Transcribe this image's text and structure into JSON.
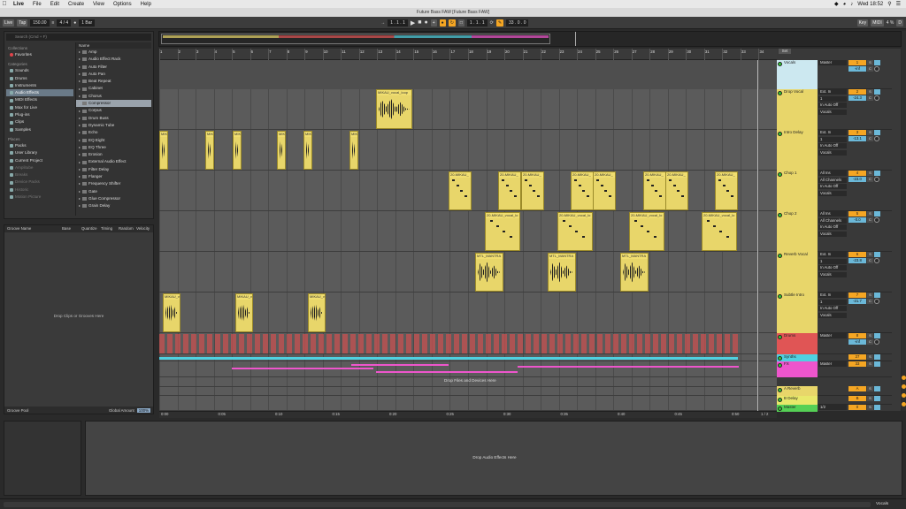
{
  "menubar": {
    "items": [
      "Live",
      "File",
      "Edit",
      "Create",
      "View",
      "Options",
      "Help"
    ],
    "clock": "Wed 18:52"
  },
  "window": {
    "title": "Future Bass FAW  [Future Bass FAW]"
  },
  "transport": {
    "link": "Live",
    "tap": "Tap",
    "tempo": "150.00",
    "sig": "4 / 4",
    "quant": "1 Bar",
    "position": "1 . 1 . 1",
    "loop_start": "1 . 1 . 1",
    "loop_len": "33 . 0 . 0",
    "key": "Key",
    "midi": "MIDI",
    "cpu": "4 %",
    "d_label": "D"
  },
  "browser": {
    "search_placeholder": "Search (Cmd + F)",
    "collections_header": "Collections",
    "collections": [
      {
        "label": "Favorites",
        "color": "#e0444b"
      }
    ],
    "categories_header": "Categories",
    "categories": [
      "Sounds",
      "Drums",
      "Instruments",
      "Audio Effects",
      "MIDI Effects",
      "Max for Live",
      "Plug-ins",
      "Clips",
      "Samples"
    ],
    "selected_category": "Audio Effects",
    "places_header": "Places",
    "places": [
      "Packs",
      "User Library",
      "Current Project",
      "Amplitube",
      "Breaks",
      "Device Packs",
      "Historic",
      "Motion Picture"
    ],
    "name_header": "Name",
    "items": [
      "Amp",
      "Audio Effect Rack",
      "Auto Filter",
      "Auto Pan",
      "Beat Repeat",
      "Cabinet",
      "Chorus",
      "Compressor",
      "Corpus",
      "Drum Buss",
      "Dynamic Tube",
      "Echo",
      "EQ Eight",
      "EQ Three",
      "Erosion",
      "External Audio Effect",
      "Filter Delay",
      "Flanger",
      "Frequency Shifter",
      "Gate",
      "Glue Compressor",
      "Grain Delay"
    ],
    "selected_item": "Compressor"
  },
  "groove": {
    "headers": [
      "Groove Name",
      "Base",
      "Quantize",
      "Timing",
      "Random",
      "Velocity"
    ],
    "drop_text": "Drop Clips or Grooves Here",
    "footer_label": "Groove Pool",
    "global_label": "Global Amount",
    "global_value": "100%"
  },
  "arrangement": {
    "bars": [
      "1",
      "2",
      "3",
      "4",
      "5",
      "6",
      "7",
      "8",
      "9",
      "10",
      "11",
      "12",
      "13",
      "14",
      "15",
      "16",
      "17",
      "18",
      "19",
      "20",
      "21",
      "22",
      "23",
      "24",
      "25",
      "26",
      "27",
      "28",
      "29",
      "30",
      "31",
      "32",
      "33",
      "34"
    ],
    "times": [
      "0:00",
      "0:05",
      "0:10",
      "0:15",
      "0:20",
      "0:25",
      "0:30",
      "0:35",
      "0:40",
      "0:45",
      "0:50"
    ],
    "drop_text": "Drop Files and Devices Here",
    "loop_indicator": "1 / 2",
    "clips": {
      "drop_vocal": "MIKAU_vocal_loop",
      "intro_delay": "MIKA",
      "chop1": "20-MIKAU_",
      "chop2": "20-MIKAU_vocal_lo",
      "reverb": "MTL_MANTRA",
      "subtle": "MIKAU_vo"
    }
  },
  "mixer": {
    "set_label": "Set",
    "tracks": [
      {
        "name": "Vocals",
        "color": "#cce8f0",
        "io": [
          "Master"
        ],
        "num": "1",
        "vol": "-inf",
        "pan": "C"
      },
      {
        "name": "Drop Vocal",
        "color": "#e8d66a",
        "io": [
          "Ext. In",
          "1",
          "In  Auto  Off",
          "Vocals"
        ],
        "num": "2",
        "vol": "-24.3",
        "pan": "C"
      },
      {
        "name": "Intro Delay",
        "color": "#e8d66a",
        "io": [
          "Ext. In",
          "1",
          "In  Auto  Off",
          "Vocals"
        ],
        "num": "3",
        "vol": "-13.1",
        "pan": "C"
      },
      {
        "name": "Chop 1",
        "color": "#e8d66a",
        "io": [
          "All Ins",
          "All Channels",
          "In  Auto  Off",
          "Vocals"
        ],
        "num": "4",
        "vol": "-23.0",
        "pan": "C"
      },
      {
        "name": "Chop 2",
        "color": "#e8d66a",
        "io": [
          "All Ins",
          "All Channels",
          "In  Auto  Off",
          "Vocals"
        ],
        "num": "5",
        "vol": "-0.0",
        "pan": "C"
      },
      {
        "name": "Reverb Vocal",
        "color": "#e8d66a",
        "io": [
          "Ext. In",
          "1",
          "In  Auto  Off",
          "Vocals"
        ],
        "num": "6",
        "vol": "-23.8",
        "pan": "C"
      },
      {
        "name": "Subtle Intro",
        "color": "#e8d66a",
        "io": [
          "Ext. In",
          "1",
          "In  Auto  Off",
          "Vocals"
        ],
        "num": "7",
        "vol": "-21.7",
        "pan": "C"
      },
      {
        "name": "Drums",
        "color": "#e05555",
        "io": [
          "Master"
        ],
        "num": "8",
        "vol": "-inf",
        "pan": "C"
      },
      {
        "name": "Synths",
        "color": "#4fd0e0",
        "io": [
          ""
        ],
        "num": "27",
        "vol": "",
        "pan": ""
      },
      {
        "name": "FX",
        "color": "#ee55cc",
        "io": [
          "Master"
        ],
        "num": "33",
        "vol": "",
        "pan": ""
      },
      {
        "name": "A Reverb",
        "color": "#e8d66a",
        "io": [
          ""
        ],
        "num": "A",
        "vol": "",
        "pan": ""
      },
      {
        "name": "B Delay",
        "color": "#e8e86a",
        "io": [
          ""
        ],
        "num": "B",
        "vol": "",
        "pan": ""
      },
      {
        "name": "Master",
        "color": "#55d055",
        "io": [
          "1/2"
        ],
        "num": "0",
        "vol": "",
        "pan": ""
      }
    ]
  },
  "detail": {
    "drop_text": "Drop Audio Effects Here",
    "status_right": "Vocals"
  }
}
